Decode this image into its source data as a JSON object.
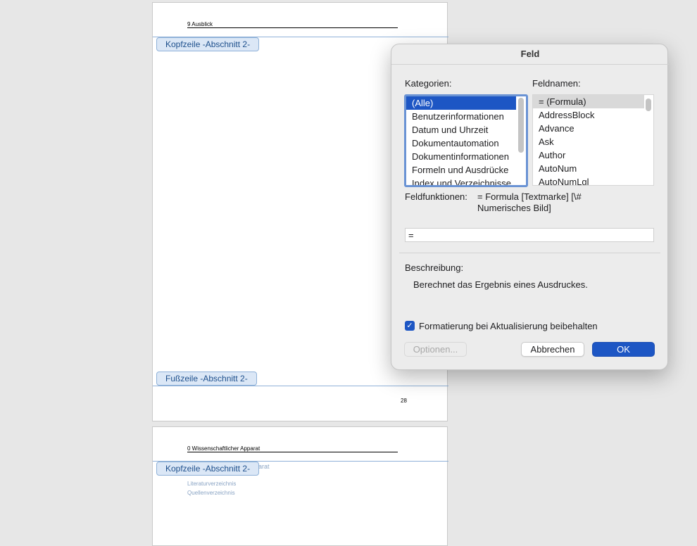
{
  "document": {
    "page1": {
      "header_text": "9 Ausblick",
      "header_section_tab": "Kopfzeile -Abschnitt 2-",
      "footer_section_tab": "Fußzeile -Abschnitt 2-",
      "page_number": "28"
    },
    "page2": {
      "header_text": "0 Wissenschaftlicher Apparat",
      "header_section_tab": "Kopfzeile -Abschnitt 2-",
      "toc_partial": "arat",
      "toc_entries": [
        "Literaturverzeichnis",
        "Quellenverzeichnis"
      ]
    }
  },
  "dialog": {
    "title": "Feld",
    "categories_label": "Kategorien:",
    "fieldnames_label": "Feldnamen:",
    "categories": [
      "(Alle)",
      "Benutzerinformationen",
      "Datum und Uhrzeit",
      "Dokumentautomation",
      "Dokumentinformationen",
      "Formeln und Ausdrücke",
      "Index und Verzeichnisse"
    ],
    "selected_category": "(Alle)",
    "fieldnames": [
      "= (Formula)",
      "AddressBlock",
      "Advance",
      "Ask",
      "Author",
      "AutoNum",
      "AutoNumLgl"
    ],
    "selected_fieldname": "= (Formula)",
    "field_functions_label": "Feldfunktionen:",
    "field_functions_text": "= Formula [Textmarke] [\\# Numerisches Bild]",
    "formula_value": "=",
    "description_label": "Beschreibung:",
    "description_text": "Berechnet das Ergebnis eines Ausdruckes.",
    "keep_formatting_label": "Formatierung bei Aktualisierung beibehalten",
    "keep_formatting_checked": true,
    "options_button": "Optionen...",
    "cancel_button": "Abbrechen",
    "ok_button": "OK",
    "accent_color": "#1d56c4"
  }
}
